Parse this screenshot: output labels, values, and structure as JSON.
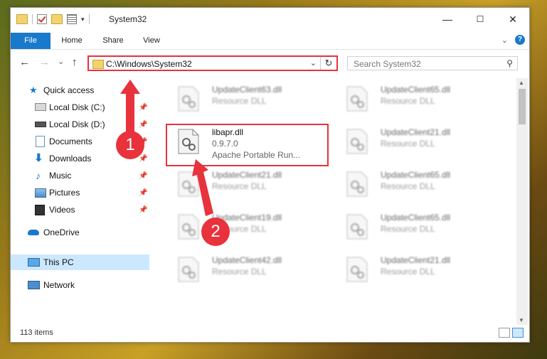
{
  "window": {
    "title": "System32"
  },
  "ribbon": {
    "tabs": [
      "File",
      "Home",
      "Share",
      "View"
    ]
  },
  "controls": {
    "minimize": "—",
    "maximize": "☐",
    "close": "✕"
  },
  "nav": {
    "back": "←",
    "forward": "→",
    "recent": "⌄",
    "up": "↑"
  },
  "address": {
    "path": "C:\\Windows\\System32"
  },
  "search": {
    "placeholder": "Search System32"
  },
  "sidebar": {
    "items": [
      {
        "label": "Quick access",
        "icon": "star-icon"
      },
      {
        "label": "Local Disk (C:)",
        "icon": "drive-icon"
      },
      {
        "label": "Local Disk (D:)",
        "icon": "drive-icon"
      },
      {
        "label": "Documents",
        "icon": "documents-icon"
      },
      {
        "label": "Downloads",
        "icon": "download-icon"
      },
      {
        "label": "Music",
        "icon": "music-icon"
      },
      {
        "label": "Pictures",
        "icon": "pictures-icon"
      },
      {
        "label": "Videos",
        "icon": "videos-icon"
      },
      {
        "label": "OneDrive",
        "icon": "cloud-icon"
      },
      {
        "label": "This PC",
        "icon": "computer-icon"
      },
      {
        "label": "Network",
        "icon": "network-icon"
      }
    ]
  },
  "files": [
    {
      "name": "UpdateClient63.dll",
      "line2": "Resource DLL",
      "line3": ""
    },
    {
      "name": "UpdateClient65.dll",
      "line2": "Resource DLL",
      "line3": ""
    },
    {
      "name": "libapr.dll",
      "line2": "0.9.7.0",
      "line3": "Apache Portable Run..."
    },
    {
      "name": "UpdateClient21.dll",
      "line2": "Resource DLL",
      "line3": ""
    },
    {
      "name": "UpdateClient21.dll",
      "line2": "Resource DLL",
      "line3": ""
    },
    {
      "name": "UpdateClient65.dll",
      "line2": "Resource DLL",
      "line3": ""
    },
    {
      "name": "UpdateClient19.dll",
      "line2": "Resource DLL",
      "line3": ""
    },
    {
      "name": "UpdateClient65.dll",
      "line2": "Resource DLL",
      "line3": ""
    },
    {
      "name": "UpdateClient42.dll",
      "line2": "Resource DLL",
      "line3": ""
    },
    {
      "name": "UpdateClient21.dll",
      "line2": "Resource DLL",
      "line3": ""
    }
  ],
  "status": {
    "items_count": "113 items"
  },
  "annotations": {
    "badge1": "1",
    "badge2": "2",
    "color": "#e8323c"
  }
}
